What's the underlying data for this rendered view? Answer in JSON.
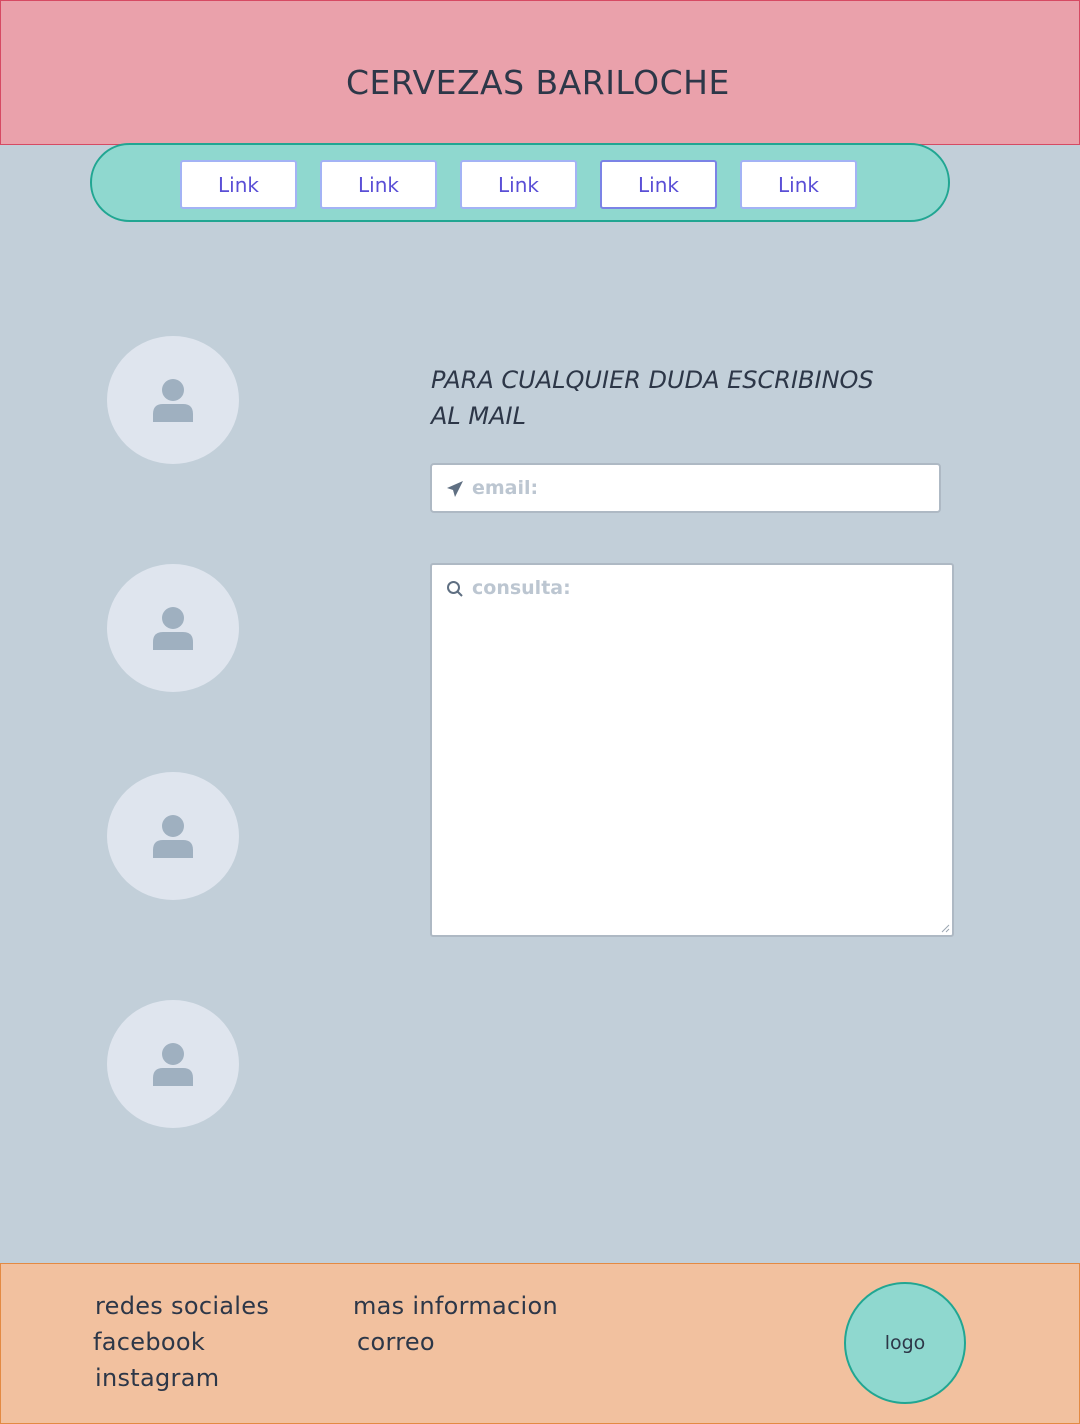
{
  "header": {
    "title": "CERVEZAS BARILOCHE"
  },
  "nav": {
    "links": [
      "Link",
      "Link",
      "Link",
      "Link",
      "Link"
    ]
  },
  "contact": {
    "heading": "PARA CUALQUIER DUDA ESCRIBINOS AL MAIL",
    "email_placeholder": "email:",
    "consulta_placeholder": "consulta:"
  },
  "footer": {
    "redes_title": "redes sociales",
    "facebook": "facebook",
    "instagram": "instagram",
    "info_title": "mas informacion",
    "correo": "correo",
    "logo": "logo"
  },
  "colors": {
    "header_bg": "#eaa1ab",
    "nav_bg": "#8fd8cf",
    "page_bg": "#c2cfd9",
    "footer_bg": "#f2c19f",
    "link_text": "#5a4fd6"
  },
  "icons": {
    "avatar": "user-icon",
    "email": "paper-plane-icon",
    "consulta": "search-icon"
  }
}
